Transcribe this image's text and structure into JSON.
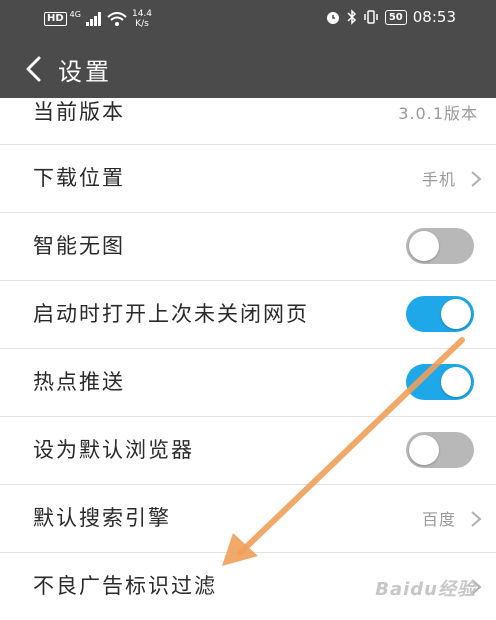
{
  "status_bar": {
    "hd": "HD",
    "network": "4G",
    "speed_value": "14.4",
    "speed_unit": "K/s",
    "battery": "50",
    "time": "08:53"
  },
  "app_bar": {
    "title": "设置"
  },
  "settings": {
    "version": {
      "label": "当前版本",
      "value": "3.0.1版本"
    },
    "download_location": {
      "label": "下载位置",
      "value": "手机"
    },
    "smart_no_image": {
      "label": "智能无图",
      "enabled": false
    },
    "restore_tabs": {
      "label": "启动时打开上次未关闭网页",
      "enabled": true
    },
    "hot_push": {
      "label": "热点推送",
      "enabled": true
    },
    "default_browser": {
      "label": "设为默认浏览器",
      "enabled": false
    },
    "search_engine": {
      "label": "默认搜索引擎",
      "value": "百度"
    },
    "ad_filter": {
      "label": "不良广告标识过滤"
    }
  },
  "watermark": "Baidu经验",
  "colors": {
    "bar": "#4b4b4b",
    "toggle_on": "#1ea8ea",
    "toggle_off": "#b8b8b8",
    "annotation_arrow": "#f0a05a"
  }
}
